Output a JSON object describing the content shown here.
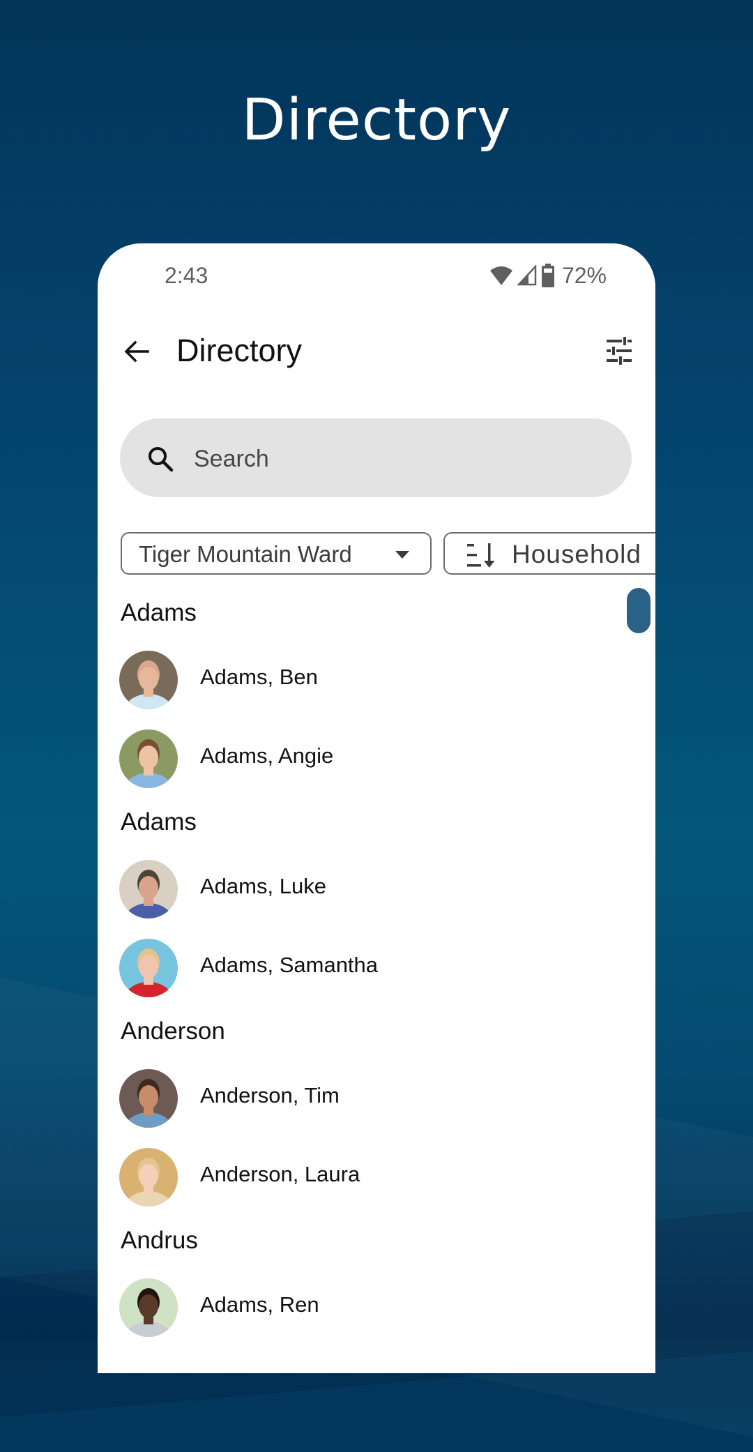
{
  "hero": {
    "title": "Directory"
  },
  "status_bar": {
    "time": "2:43",
    "battery": "72%",
    "icons": [
      "wifi-icon",
      "cell-signal-icon",
      "battery-icon"
    ]
  },
  "app_bar": {
    "title": "Directory",
    "back_icon": "arrow-left-icon",
    "filter_icon": "tune-sliders-icon"
  },
  "search": {
    "placeholder": "Search",
    "value": "",
    "icon": "search-icon"
  },
  "filters": {
    "unit": {
      "label": "Tiger Mountain Ward",
      "icon": "caret-down-icon"
    },
    "sort": {
      "label": "Household",
      "icon": "sort-descending-icon"
    }
  },
  "colors": {
    "accent": "#2a6186",
    "background_top": "#033459",
    "background_mid": "#035779",
    "search_bg": "#e3e3e3"
  },
  "sections": [
    {
      "header": "Adams",
      "members": [
        {
          "name": "Adams, Ben",
          "avatar": {
            "bg": "#7a6a5a",
            "skin": "#e6b79a",
            "shirt": "#cfe7f2",
            "hair": "#d8a88c"
          }
        },
        {
          "name": "Adams, Angie",
          "avatar": {
            "bg": "#8a9a62",
            "skin": "#edc3a3",
            "shirt": "#87b6e0",
            "hair": "#7a4e33"
          }
        }
      ]
    },
    {
      "header": "Adams",
      "members": [
        {
          "name": "Adams, Luke",
          "avatar": {
            "bg": "#d9cfc2",
            "skin": "#d9a489",
            "shirt": "#4b5fa8",
            "hair": "#4a4535"
          }
        },
        {
          "name": "Adams, Samantha",
          "avatar": {
            "bg": "#76c4dd",
            "skin": "#f0c4ae",
            "shirt": "#d5252c",
            "hair": "#e3c28d"
          }
        }
      ]
    },
    {
      "header": "Anderson",
      "members": [
        {
          "name": "Anderson, Tim",
          "avatar": {
            "bg": "#6e5a54",
            "skin": "#c98c6a",
            "shirt": "#6d9cc4",
            "hair": "#3a2a20"
          }
        },
        {
          "name": "Anderson, Laura",
          "avatar": {
            "bg": "#d9b170",
            "skin": "#f3d0b7",
            "shirt": "#e8d6b5",
            "hair": "#e2c68f"
          }
        }
      ]
    },
    {
      "header": "Andrus",
      "members": [
        {
          "name": "Adams, Ren",
          "avatar": {
            "bg": "#cfe3c4",
            "skin": "#5a3a28",
            "shirt": "#c8ccd3",
            "hair": "#1e1410"
          }
        }
      ]
    }
  ]
}
